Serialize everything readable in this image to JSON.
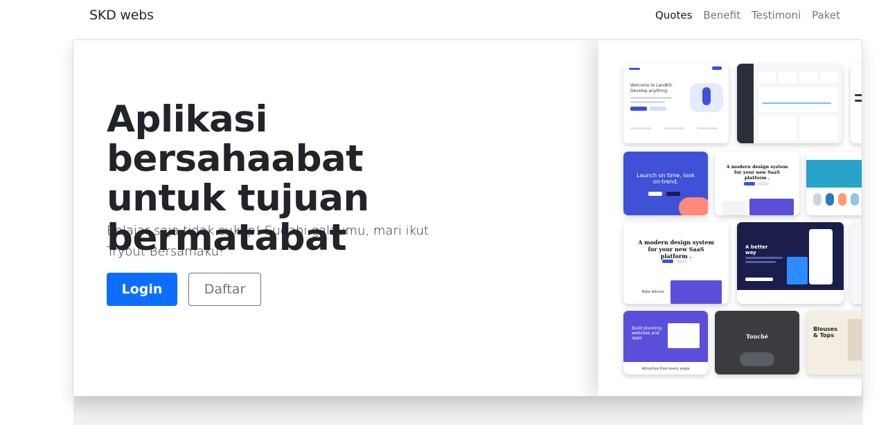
{
  "navbar": {
    "brand": "SKD webs",
    "links": [
      {
        "label": "Quotes",
        "active": true
      },
      {
        "label": "Benefit",
        "active": false
      },
      {
        "label": "Testimoni",
        "active": false
      },
      {
        "label": "Paket",
        "active": false
      }
    ]
  },
  "hero": {
    "title_line1": "Aplikasi bersahaabat",
    "title_line2": "untuk tujuan",
    "title_line3": "bermatabat",
    "lead": "Belajar saja tidak cukup! Sudahi galaumu, mari ikut Tryout Bersamaku!",
    "login_label": "Login",
    "daftar_label": "Daftar"
  },
  "mockup": {
    "t1_heading": "Welcome to LandKit. Develop anything.",
    "t4_heading": "Launch on time, look on-trend.",
    "t5_heading": "A modern design system for your new SaaS platform .",
    "t7_heading": "A modern design system for your new SaaS platform .",
    "t7_footer": "Robo Advisor",
    "t8_heading": "A better way",
    "t10_heading": "Build stunning websites and apps",
    "t10_footer": "Attractive from every angle",
    "t11_heading": "Touché",
    "t12_heading": "Blouses & Tops",
    "accent_color": "#0d6efd",
    "colors": {
      "indigo": "#3f51d6",
      "navy": "#1b1d4a",
      "dark": "#2a2f3a",
      "teal": "#29a3c9",
      "purple": "#5b4fd9"
    }
  }
}
